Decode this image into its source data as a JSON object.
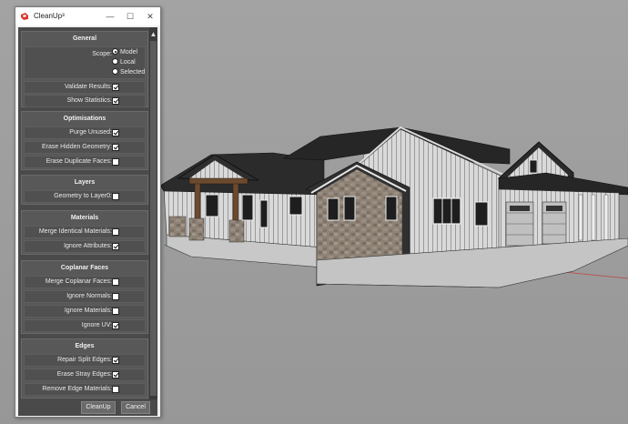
{
  "window": {
    "title": "CleanUp³",
    "minimize_glyph": "—",
    "maximize_glyph": "☐",
    "close_glyph": "✕",
    "icon": "sketchup-red-icon"
  },
  "sections": {
    "general": {
      "heading": "General",
      "scope_label": "Scope:",
      "scope_options": [
        "Model",
        "Local",
        "Selected"
      ],
      "scope_selected": "Model",
      "validate_label": "Validate Results:",
      "validate_checked": true,
      "statistics_label": "Show Statistics:",
      "statistics_checked": true
    },
    "optimisations": {
      "heading": "Optimisations",
      "purge_label": "Purge Unused:",
      "purge_checked": true,
      "erase_hidden_label": "Erase Hidden Geometry:",
      "erase_hidden_checked": true,
      "erase_duplicate_label": "Erase Duplicate Faces:",
      "erase_duplicate_checked": false
    },
    "layers": {
      "heading": "Layers",
      "geometry_layer0_label": "Geometry to Layer0:",
      "geometry_layer0_checked": false
    },
    "materials": {
      "heading": "Materials",
      "merge_identical_label": "Merge Identical Materials:",
      "merge_identical_checked": false,
      "ignore_attributes_label": "Ignore Attributes:",
      "ignore_attributes_checked": true
    },
    "coplanar": {
      "heading": "Coplanar Faces",
      "merge_coplanar_label": "Merge Coplanar Faces:",
      "merge_coplanar_checked": false,
      "ignore_normals_label": "Ignore Normals:",
      "ignore_normals_checked": false,
      "ignore_materials_label": "Ignore Materials:",
      "ignore_materials_checked": false,
      "ignore_uv_label": "Ignore UV:",
      "ignore_uv_checked": true
    },
    "edges": {
      "heading": "Edges",
      "repair_split_label": "Repair Split Edges:",
      "repair_split_checked": true,
      "erase_stray_label": "Erase Stray Edges:",
      "erase_stray_checked": true,
      "remove_materials_label": "Remove Edge Materials:",
      "remove_materials_checked": false
    }
  },
  "footer": {
    "cleanup_label": "CleanUp",
    "cancel_label": "Cancel"
  },
  "scrollbar": {
    "up_glyph": "▲"
  },
  "colors": {
    "dialog_bg": "#4a4a4a",
    "section_bg": "#585858",
    "viewport_bg": "#9b9b9b",
    "roof": "#2a2a2a",
    "siding": "#d6d6d6",
    "stone": "#8d8275",
    "timber": "#6b4a30",
    "axis_red": "#c0392b",
    "axis_green": "#27ae60"
  }
}
